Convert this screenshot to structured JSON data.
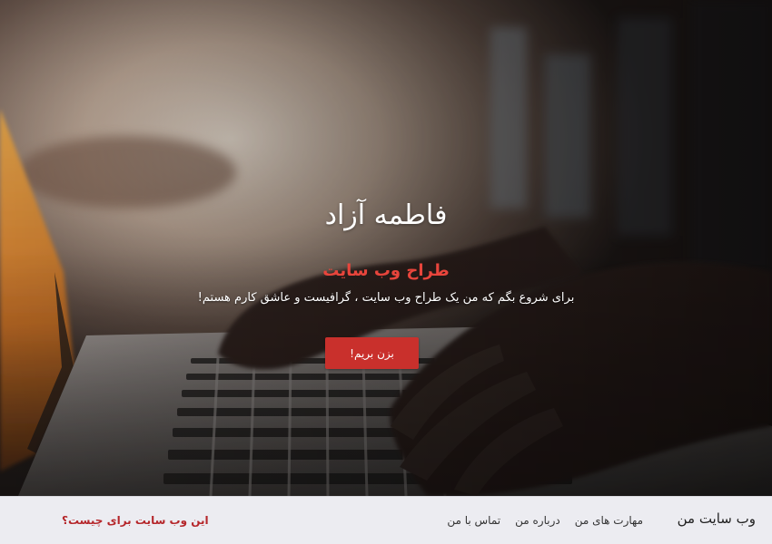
{
  "hero": {
    "name": "فاطمه آزاد",
    "role": "طراح وب سایت",
    "description": "برای شروع بگم که من یک طراح وب سایت ، گرافیست و عاشق کارم هستم!",
    "button_label": "بزن بریم!",
    "background_image": "blurred photo of hands typing on laptop keyboard"
  },
  "navbar": {
    "brand": "وب سایت من",
    "links": [
      {
        "label": "مهارت های من"
      },
      {
        "label": "درباره من"
      },
      {
        "label": "تماس با من"
      }
    ],
    "question": "این وب سایت برای چیست؟"
  },
  "colors": {
    "accent_red": "#e8453c",
    "button_red": "#c9302c",
    "question_red": "#b5262a",
    "navbar_bg": "#ececf1"
  }
}
